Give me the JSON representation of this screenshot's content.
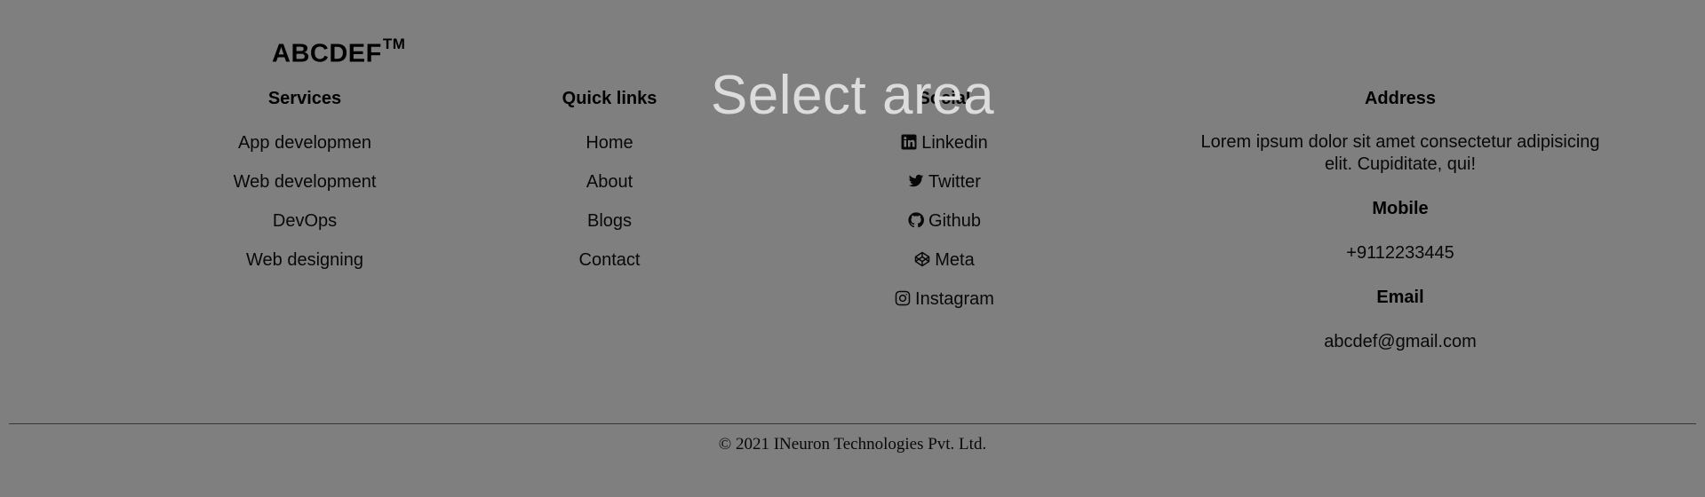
{
  "brand": {
    "name": "ABCDEF",
    "trademark": "TM"
  },
  "services": {
    "heading": "Services",
    "items": [
      "App developmen",
      "Web development",
      "DevOps",
      "Web designing"
    ]
  },
  "quick_links": {
    "heading": "Quick links",
    "items": [
      "Home",
      "About",
      "Blogs",
      "Contact"
    ]
  },
  "social": {
    "heading": "Social",
    "items": [
      {
        "label": "Linkedin",
        "icon": "linkedin-icon"
      },
      {
        "label": "Twitter",
        "icon": "twitter-icon"
      },
      {
        "label": "Github",
        "icon": "github-icon"
      },
      {
        "label": "Meta",
        "icon": "meta-icon"
      },
      {
        "label": "Instagram",
        "icon": "instagram-icon"
      }
    ]
  },
  "address": {
    "heading": "Address",
    "text": "Lorem ipsum dolor sit amet consectetur adipisicing elit. Cupiditate, qui!",
    "mobile_heading": "Mobile",
    "mobile": "+9112233445",
    "email_heading": "Email",
    "email": "abcdef@gmail.com"
  },
  "footer": {
    "copyright": "© 2021 INeuron Technologies Pvt. Ltd."
  },
  "overlay": {
    "label": "Select area",
    "dim_color": "#000000"
  }
}
